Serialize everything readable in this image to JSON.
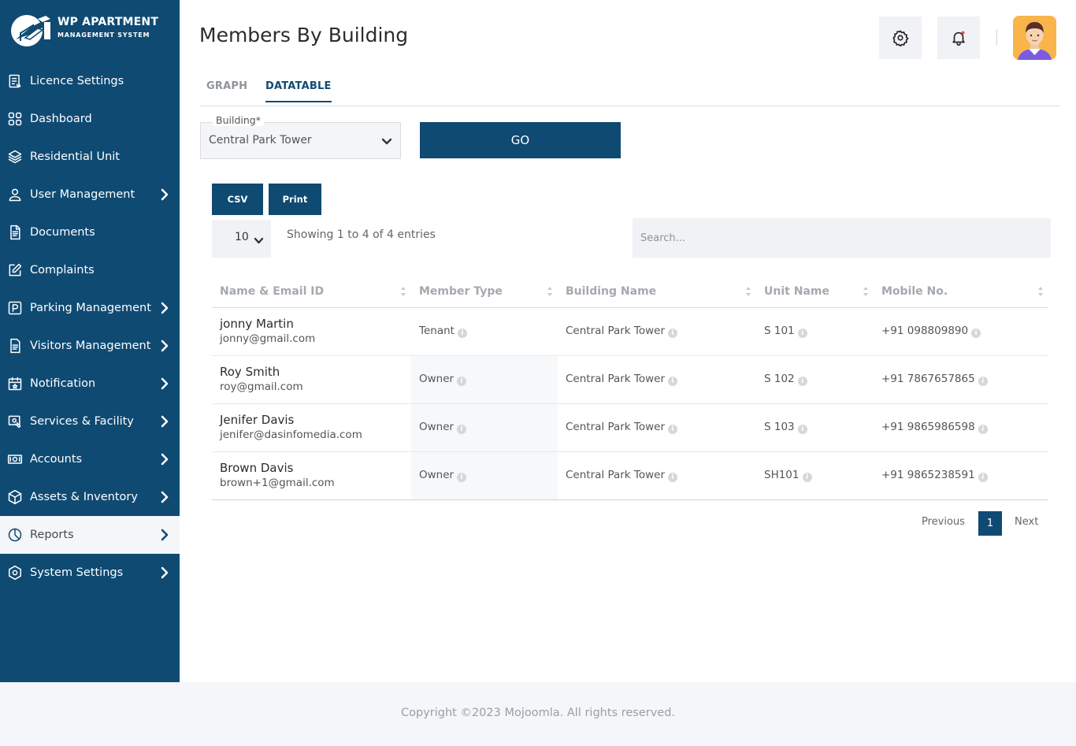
{
  "brand": {
    "title": "WP APARTMENT",
    "subtitle": "MANAGEMENT SYSTEM",
    "accent": "#0f4a73"
  },
  "sidebar": {
    "items": [
      {
        "label": "Licence Settings",
        "icon": "licence-icon",
        "chevron": false
      },
      {
        "label": "Dashboard",
        "icon": "dashboard-icon",
        "chevron": false
      },
      {
        "label": "Residential Unit",
        "icon": "layers-icon",
        "chevron": false
      },
      {
        "label": "User Management",
        "icon": "user-icon",
        "chevron": true
      },
      {
        "label": "Documents",
        "icon": "document-icon",
        "chevron": false
      },
      {
        "label": "Complaints",
        "icon": "edit-icon",
        "chevron": false
      },
      {
        "label": "Parking Management",
        "icon": "parking-icon",
        "chevron": true
      },
      {
        "label": "Visitors Management",
        "icon": "visitors-icon",
        "chevron": true
      },
      {
        "label": "Notification",
        "icon": "calendar-icon",
        "chevron": true
      },
      {
        "label": "Services & Facility",
        "icon": "services-icon",
        "chevron": true
      },
      {
        "label": "Accounts",
        "icon": "money-icon",
        "chevron": true
      },
      {
        "label": "Assets & Inventory",
        "icon": "box-icon",
        "chevron": true
      },
      {
        "label": "Reports",
        "icon": "pie-chart-icon",
        "chevron": true,
        "active": true
      },
      {
        "label": "System Settings",
        "icon": "settings-hex-icon",
        "chevron": true
      }
    ]
  },
  "header": {
    "title": "Members By Building"
  },
  "tabs": [
    {
      "label": "GRAPH"
    },
    {
      "label": "DATATABLE",
      "active": true
    }
  ],
  "filter": {
    "label": "Building*",
    "value": "Central Park Tower",
    "go_label": "GO"
  },
  "export": {
    "csv_label": "CSV",
    "print_label": "Print"
  },
  "table_controls": {
    "page_length": "10",
    "info": "Showing 1 to 4 of 4 entries",
    "search_placeholder": "Search..."
  },
  "table": {
    "columns": [
      "Name & Email ID",
      "Member Type",
      "Building Name",
      "Unit Name",
      "Mobile No."
    ],
    "rows": [
      {
        "name": "jonny Martin",
        "email": "jonny@gmail.com",
        "type": "Tenant",
        "building": "Central Park Tower",
        "unit": "S 101",
        "mobile": "+91 098809890"
      },
      {
        "name": "Roy Smith",
        "email": "roy@gmail.com",
        "type": "Owner",
        "building": "Central Park Tower",
        "unit": "S 102",
        "mobile": "+91 7867657865"
      },
      {
        "name": "Jenifer Davis",
        "email": "jenifer@dasinfomedia.com",
        "type": "Owner",
        "building": "Central Park Tower",
        "unit": "S 103",
        "mobile": "+91 9865986598"
      },
      {
        "name": "Brown Davis",
        "email": "brown+1@gmail.com",
        "type": "Owner",
        "building": "Central Park Tower",
        "unit": "SH101",
        "mobile": "+91 9865238591"
      }
    ]
  },
  "pagination": {
    "previous": "Previous",
    "current": "1",
    "next": "Next"
  },
  "footer": {
    "text": "Copyright ©2023 Mojoomla. All rights reserved."
  }
}
